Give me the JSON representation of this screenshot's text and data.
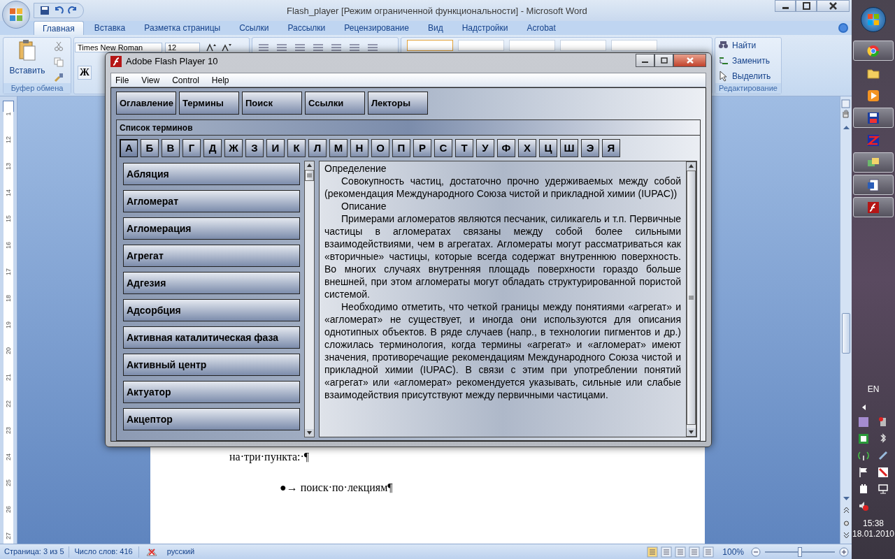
{
  "word": {
    "title": "Flash_player [Режим ограниченной функциональности] - Microsoft Word",
    "tabs": [
      {
        "label": "Главная",
        "selected": true
      },
      {
        "label": "Вставка",
        "selected": false
      },
      {
        "label": "Разметка страницы",
        "selected": false
      },
      {
        "label": "Ссылки",
        "selected": false
      },
      {
        "label": "Рассылки",
        "selected": false
      },
      {
        "label": "Рецензирование",
        "selected": false
      },
      {
        "label": "Вид",
        "selected": false
      },
      {
        "label": "Надстройки",
        "selected": false
      },
      {
        "label": "Acrobat",
        "selected": false
      }
    ],
    "ribbon": {
      "paste_label": "Вставить",
      "clipboard_label": "Буфер обмена",
      "font_name": "Times New Roman",
      "font_size": "12",
      "bold_key": "Ж",
      "find": "Найти",
      "replace": "Заменить",
      "select": "Выделить",
      "editing_label": "Редактирование"
    },
    "ruler_numbers": [
      "1",
      "12",
      "13",
      "14",
      "15",
      "16",
      "17",
      "18",
      "19",
      "20",
      "21",
      "22",
      "23",
      "24",
      "25",
      "26",
      "27"
    ],
    "document_lines": [
      {
        "kind": "text",
        "text": "на·три·пункта:·¶"
      },
      {
        "kind": "bullet",
        "text": "●→ поиск·по·лекциям¶"
      }
    ],
    "status_bar": {
      "page": "Страница: 3 из 5",
      "words": "Число слов: 416",
      "language": "русский",
      "zoom": "100%",
      "zoom_slider": {
        "level": 0.5
      }
    }
  },
  "flash": {
    "title": "Adobe Flash Player 10",
    "menu": [
      "File",
      "View",
      "Control",
      "Help"
    ],
    "tabs": [
      "Оглавление",
      "Термины",
      "Поиск",
      "Ссылки",
      "Лекторы"
    ],
    "panel_title": "Список терминов",
    "letters": [
      {
        "label": "А",
        "selected": true
      },
      {
        "label": "Б",
        "selected": false
      },
      {
        "label": "В",
        "selected": false
      },
      {
        "label": "Г",
        "selected": false
      },
      {
        "label": "Д",
        "selected": false
      },
      {
        "label": "Ж",
        "selected": false
      },
      {
        "label": "З",
        "selected": false
      },
      {
        "label": "И",
        "selected": false
      },
      {
        "label": "К",
        "selected": false
      },
      {
        "label": "Л",
        "selected": false
      },
      {
        "label": "М",
        "selected": false
      },
      {
        "label": "Н",
        "selected": false
      },
      {
        "label": "О",
        "selected": false
      },
      {
        "label": "П",
        "selected": false
      },
      {
        "label": "Р",
        "selected": false
      },
      {
        "label": "С",
        "selected": false
      },
      {
        "label": "Т",
        "selected": false
      },
      {
        "label": "У",
        "selected": false
      },
      {
        "label": "Ф",
        "selected": false
      },
      {
        "label": "Х",
        "selected": false
      },
      {
        "label": "Ц",
        "selected": false
      },
      {
        "label": "Ш",
        "selected": false
      },
      {
        "label": "Э",
        "selected": false
      },
      {
        "label": "Я",
        "selected": false
      }
    ],
    "terms": [
      "Абляция",
      "Агломерат",
      "Агломерация",
      "Агрегат",
      "Адгезия",
      "Адсорбция",
      "Активная каталитическая фаза",
      "Активный центр",
      "Актуатор",
      "Акцептор"
    ],
    "article": [
      {
        "kind": "heading",
        "text": "Определение"
      },
      {
        "kind": "paragraph",
        "text": "Совокупность частиц, достаточно прочно удерживаемых между собой (рекомендация Международного Союза чистой и прикладной химии (IUPAC))"
      },
      {
        "kind": "paragraph",
        "text": "Описание"
      },
      {
        "kind": "paragraph",
        "text": "Примерами агломератов являются песчаник, силикагель и т.п. Первичные частицы в агломератах связаны между собой более сильными взаимодействиями, чем в агрегатах. Агломераты могут рассматриваться как «вторичные» частицы, которые всегда содержат внутреннюю поверхность. Во многих случаях внутренняя площадь поверхности гораздо больше внешней, при этом агломераты могут обладать структурированной пористой системой."
      },
      {
        "kind": "paragraph",
        "text": "Необходимо отметить, что четкой границы между понятиями «агрегат» и «агломерат» не существует, и иногда они используются для описания однотипных объектов. В ряде случаев (напр., в технологии пигментов и др.) сложилась терминология, когда термины «агрегат» и «агломерат» имеют значения, противоречащие рекомендациям Международного Союза чистой и прикладной химии (IUPAC). В связи с этим при употреблении понятий «агрегат» или «агломерат» рекомендуется указывать, сильные или слабые взаимодействия присутствуют между первичными частицами."
      }
    ]
  },
  "taskbar": {
    "apps": [
      {
        "kind": "ring",
        "active": true
      },
      {
        "kind": "folder",
        "active": false
      },
      {
        "kind": "play",
        "active": false
      },
      {
        "kind": "floppy",
        "active": true
      },
      {
        "kind": "zigzag",
        "active": false
      },
      {
        "kind": "tiles",
        "active": true
      },
      {
        "kind": "document",
        "active": true
      },
      {
        "kind": "flash",
        "active": true
      }
    ],
    "language": "EN",
    "time": "15:38",
    "date": "18.01.2010"
  }
}
